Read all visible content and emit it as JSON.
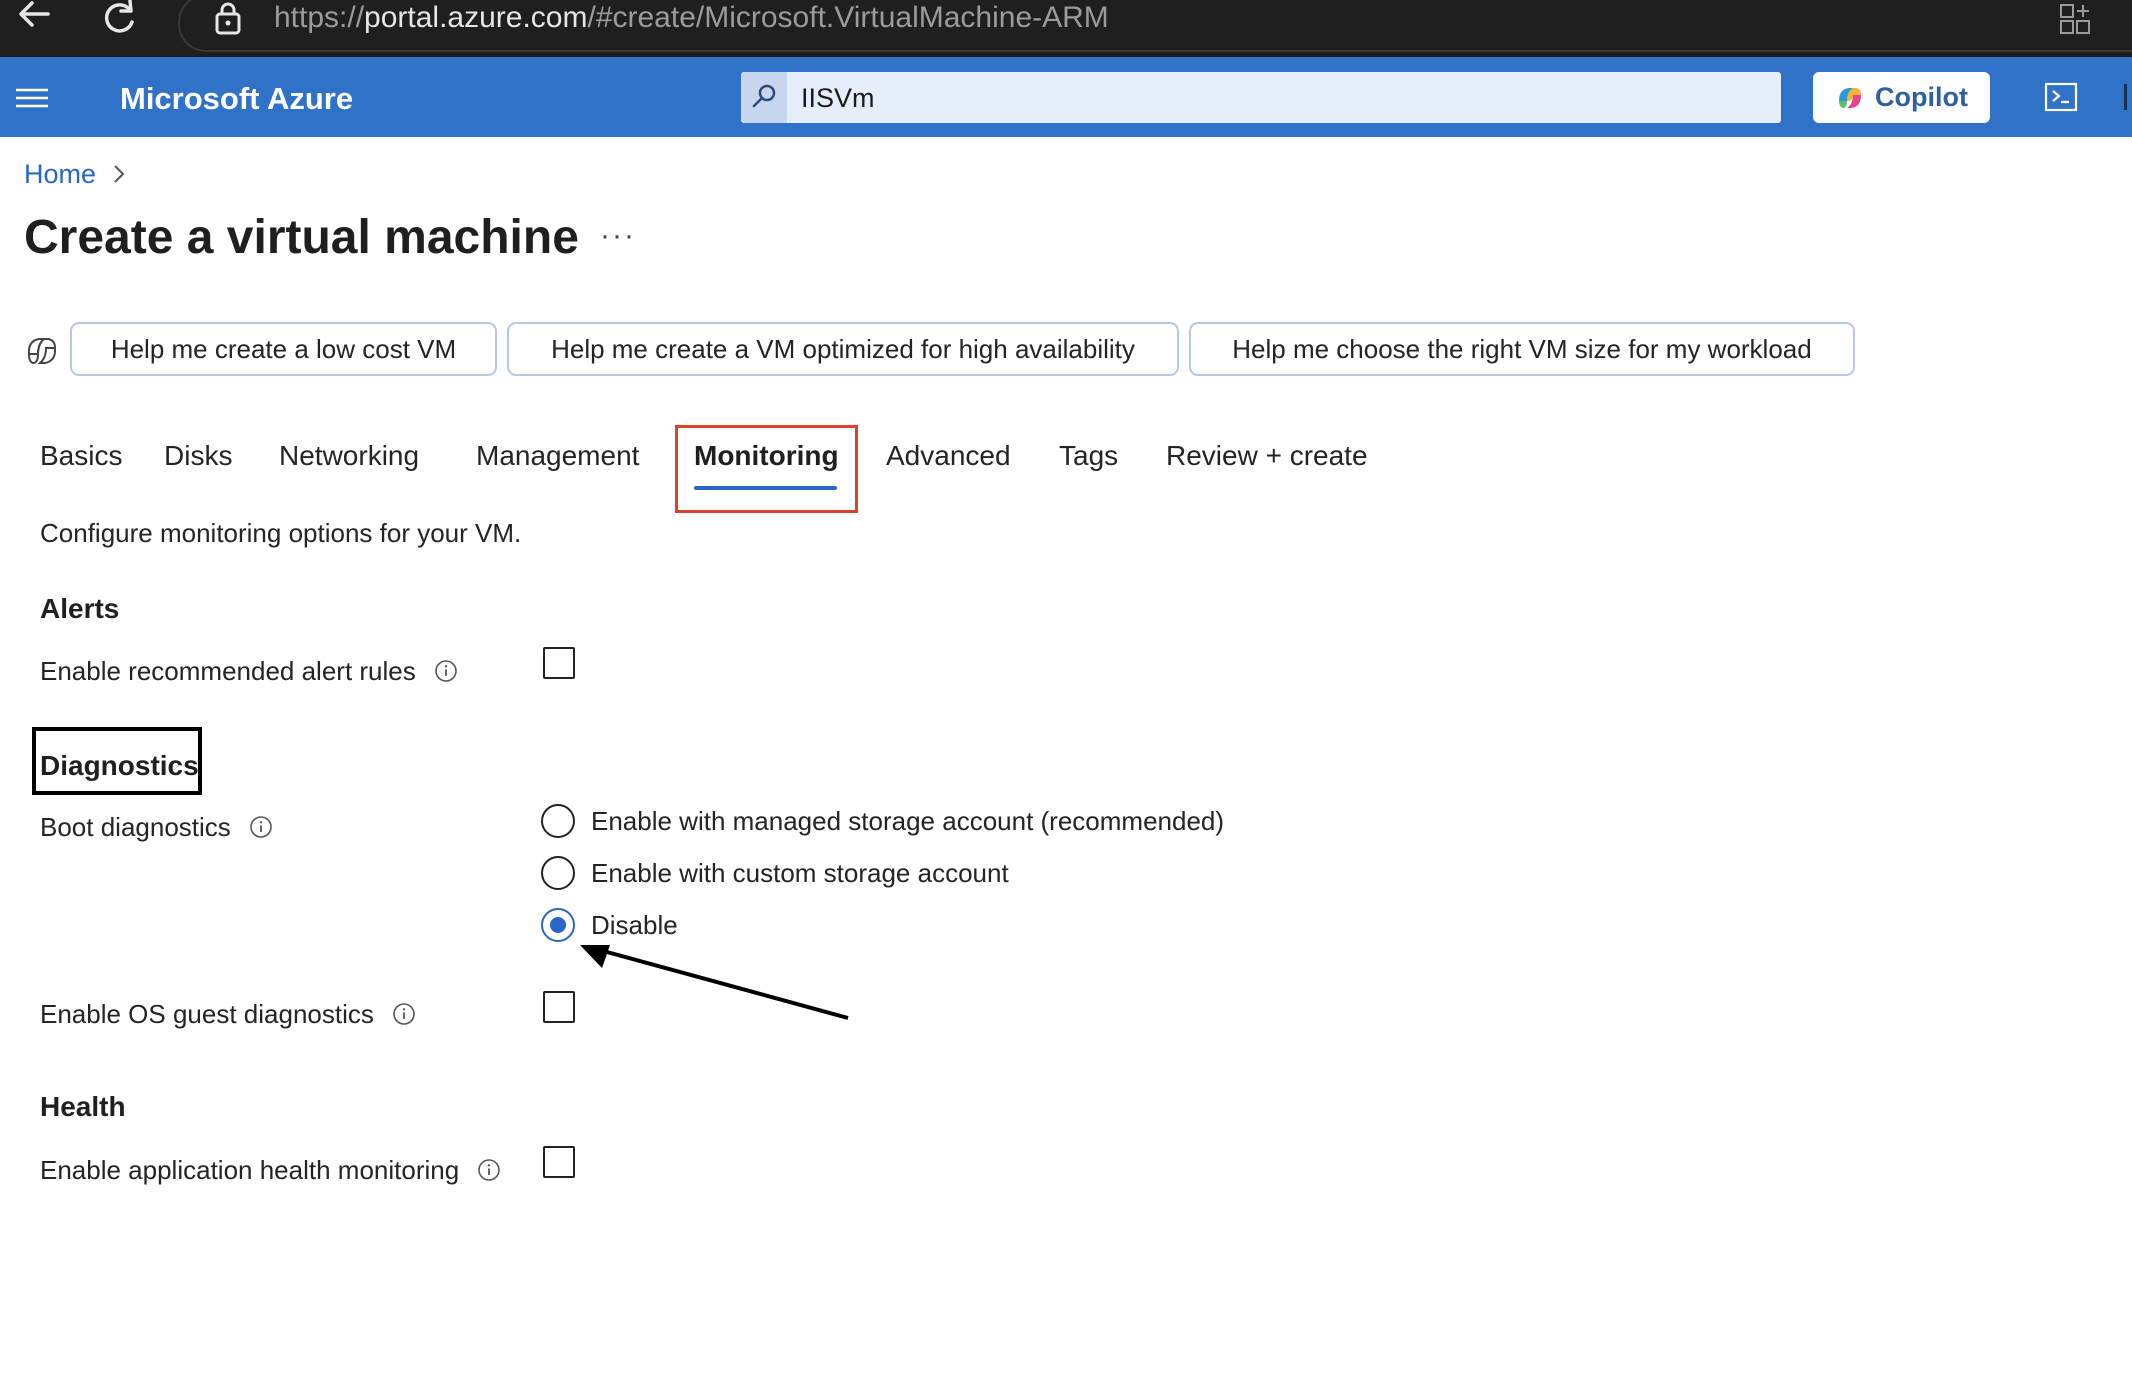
{
  "browser": {
    "url_prefix": "https://",
    "url_host": "portal.azure.com",
    "url_path": "/#create/Microsoft.VirtualMachine-ARM"
  },
  "header": {
    "brand": "Microsoft Azure",
    "search_value": "IISVm",
    "copilot_label": "Copilot"
  },
  "breadcrumb": {
    "home": "Home"
  },
  "page": {
    "title": "Create a virtual machine",
    "more": "···"
  },
  "suggestions": [
    "Help me create a low cost VM",
    "Help me create a VM optimized for high availability",
    "Help me choose the right VM size for my workload"
  ],
  "tabs": [
    "Basics",
    "Disks",
    "Networking",
    "Management",
    "Monitoring",
    "Advanced",
    "Tags",
    "Review + create"
  ],
  "active_tab": "Monitoring",
  "monitoring": {
    "intro": "Configure monitoring options for your VM.",
    "alerts": {
      "heading": "Alerts",
      "enable_alert_rules_label": "Enable recommended alert rules",
      "enable_alert_rules_checked": false
    },
    "diagnostics": {
      "heading": "Diagnostics",
      "boot_label": "Boot diagnostics",
      "boot_options": [
        "Enable with managed storage account (recommended)",
        "Enable with custom storage account",
        "Disable"
      ],
      "boot_selected": "Disable",
      "os_guest_label": "Enable OS guest diagnostics",
      "os_guest_checked": false
    },
    "health": {
      "heading": "Health",
      "app_health_label": "Enable application health monitoring",
      "app_health_checked": false
    }
  },
  "colors": {
    "azure_blue": "#2f72c7",
    "link_blue": "#2866c8",
    "highlight_red": "#e0402a"
  }
}
